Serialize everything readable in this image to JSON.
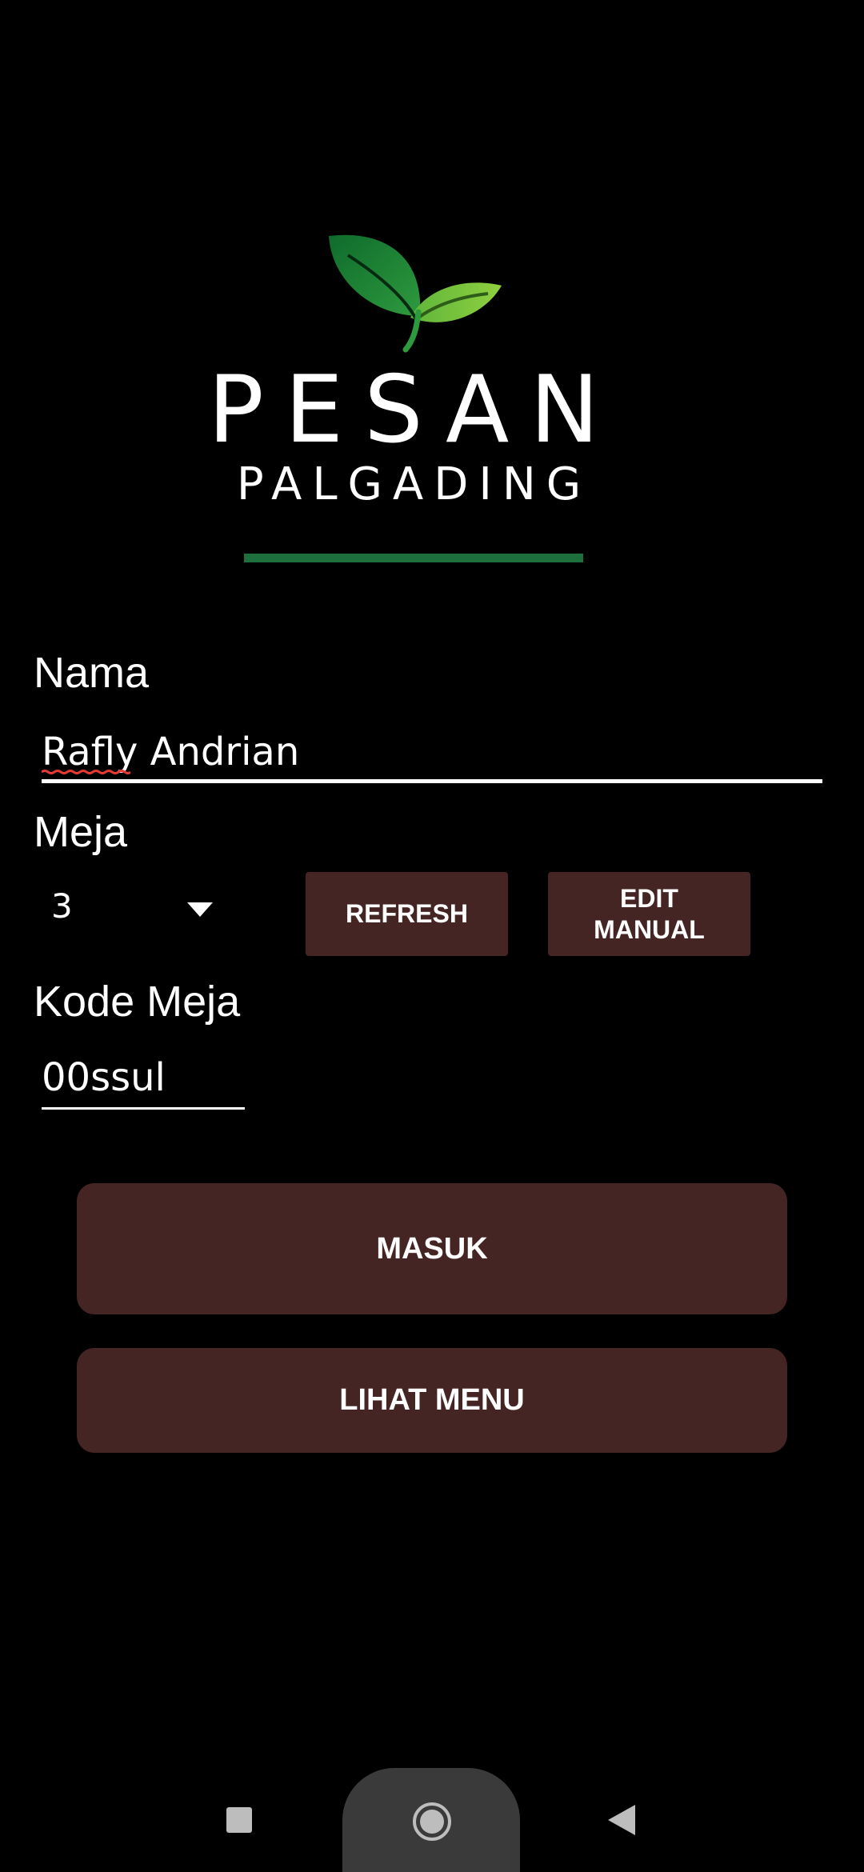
{
  "brand": {
    "title": "PESAN",
    "subtitle": "PALGADING",
    "logo_icon": "leaf-sprout-icon",
    "accent_color": "#1d6f3b"
  },
  "form": {
    "nama_label": "Nama",
    "nama_value": "Rafly Andrian",
    "meja_label": "Meja",
    "meja_value": "3",
    "kode_label": "Kode Meja",
    "kode_value": "00ssul"
  },
  "buttons": {
    "refresh": "REFRESH",
    "edit_manual": "EDIT\nMANUAL",
    "masuk": "MASUK",
    "lihat_menu": "LIHAT MENU",
    "button_color": "#452524"
  },
  "navbar": {
    "recents_icon": "square-icon",
    "home_icon": "circle-home-icon",
    "back_icon": "triangle-back-icon"
  }
}
